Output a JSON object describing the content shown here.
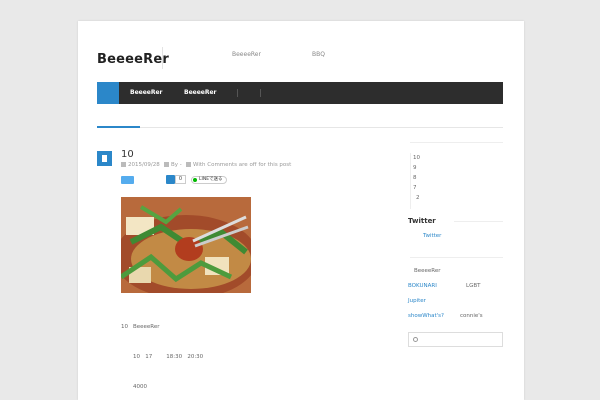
{
  "header": {
    "site_title": "BeeeeRer",
    "links": [
      "BeeeeRer",
      "BBQ"
    ]
  },
  "nav": {
    "items": [
      "BeeeeRer",
      "BeeeeRer"
    ]
  },
  "post": {
    "title": "10",
    "date": "2015/09/28",
    "author": "By -",
    "comments": "With Comments are off for this post",
    "hatena_count": "0",
    "line_label": "LINEで送る",
    "paragraphs": [
      {
        "num": "10",
        "text": "BeeeeRer"
      },
      {
        "num": "",
        "text": "10   17        18:30   20:30"
      },
      {
        "num": "",
        "text": "4000"
      }
    ]
  },
  "sidebar": {
    "numbers": [
      "10",
      "9",
      "8",
      "7",
      "2"
    ],
    "twitter_heading": "Twitter",
    "twitter_link": "Twitter",
    "site_label": "BeeeeRer",
    "links": [
      {
        "label": "BOKUNARI",
        "type": "link"
      },
      {
        "label": "LGBT",
        "type": "text"
      },
      {
        "label": "Jupiter",
        "type": "link"
      },
      {
        "label": "showWhat's?",
        "type": "link"
      },
      {
        "label": "connie's",
        "type": "text"
      }
    ]
  },
  "colors": {
    "accent": "#2b87c9",
    "nav_bg": "#2d2d2d",
    "twitter": "#55acee",
    "line": "#00b900"
  }
}
